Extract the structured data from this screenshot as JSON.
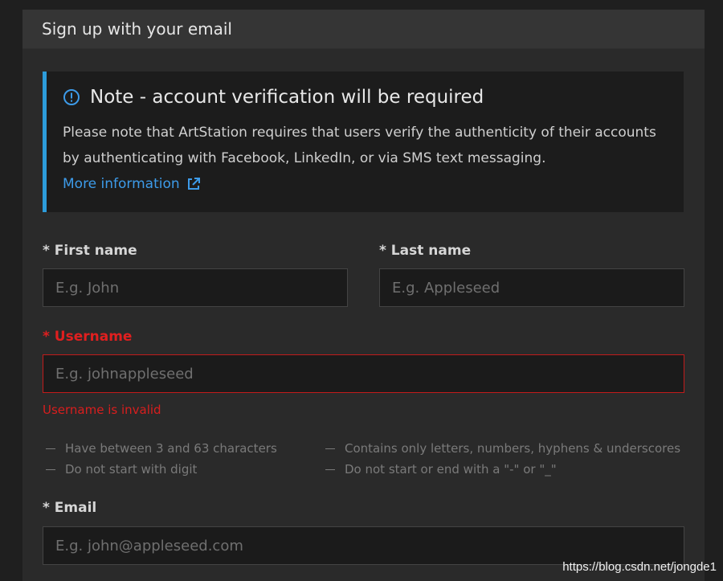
{
  "form": {
    "header_title": "Sign up with your email",
    "note": {
      "title": "Note - account verification will be required",
      "body": "Please note that ArtStation requires that users verify the authenticity of their accounts by authenticating with Facebook, LinkedIn, or via SMS text messaging.",
      "link_label": "More information",
      "accent_color": "#2d9cdb"
    },
    "first_name": {
      "label": "* First name",
      "placeholder": "E.g. John"
    },
    "last_name": {
      "label": "* Last name",
      "placeholder": "E.g. Appleseed"
    },
    "username": {
      "label": "* Username",
      "placeholder": "E.g. johnappleseed",
      "error": "Username is invalid",
      "error_color": "#e01f1f",
      "rules": [
        "Have between 3 and 63 characters",
        "Contains only letters, numbers, hyphens & underscores",
        "Do not start with digit",
        "Do not start or end with a \"-\" or \"_\""
      ]
    },
    "email": {
      "label": "* Email",
      "placeholder": "E.g. john@appleseed.com"
    }
  },
  "watermark": "https://blog.csdn.net/jongde1"
}
